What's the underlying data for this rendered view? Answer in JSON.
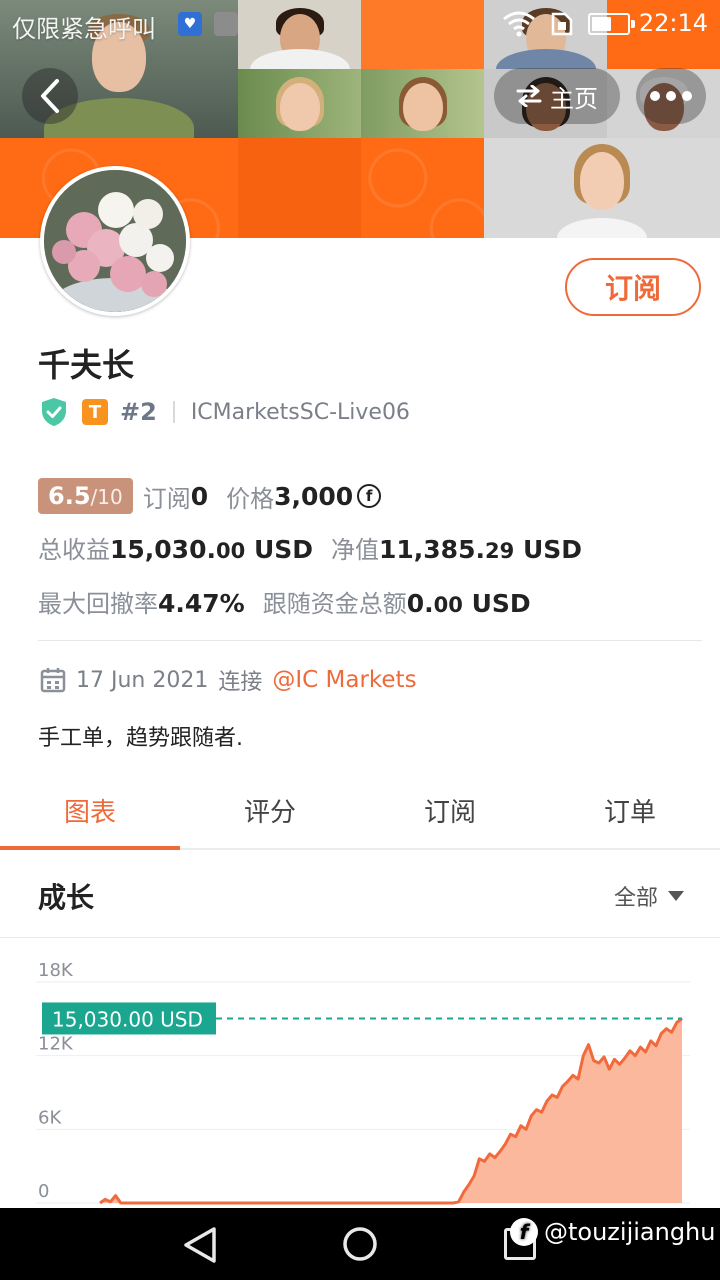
{
  "status_bar": {
    "carrier": "仅限紧急呼叫",
    "time": "22:14",
    "battery_level": 0.55,
    "icons": [
      "health-icon",
      "gallery-icon",
      "wifi-icon",
      "sim-icon",
      "battery-icon"
    ]
  },
  "header": {
    "home_label": "主页"
  },
  "subscribe_label": "订阅",
  "profile": {
    "name": "千夫长",
    "tier": "T",
    "rank": "#2",
    "server": "ICMarketsSC-Live06"
  },
  "stats": {
    "score_value": "6.5",
    "score_max": "/10",
    "subscriptions_label": "订阅",
    "subscriptions_value": "0",
    "price_label": "价格",
    "price_value": "3,000",
    "total_profit_label": "总收益",
    "total_profit_int": "15,030.",
    "total_profit_dec": "00",
    "total_profit_unit": "USD",
    "equity_label": "净值",
    "equity_int": "11,385.",
    "equity_dec": "29",
    "equity_unit": "USD",
    "max_drawdown_label": "最大回撤率",
    "max_drawdown_value": "4.47%",
    "follow_funds_label": "跟随资金总额",
    "follow_funds_int": "0.",
    "follow_funds_dec": "00",
    "follow_funds_unit": "USD"
  },
  "join": {
    "date": "17 Jun 2021",
    "connect_label": "连接",
    "broker": "@IC Markets"
  },
  "bio": "手工单，趋势跟随者.",
  "tabs": [
    {
      "label": "图表",
      "active": true
    },
    {
      "label": "评分",
      "active": false
    },
    {
      "label": "订阅",
      "active": false
    },
    {
      "label": "订单",
      "active": false
    }
  ],
  "growth": {
    "title": "成长",
    "range": "全部"
  },
  "chart_data": {
    "type": "area",
    "y_ticks": [
      "18K",
      "12K",
      "6K",
      "0"
    ],
    "ylim": [
      0,
      18000
    ],
    "current_value_label": "15,030.00 USD",
    "current_value": 15030,
    "colors": {
      "line": "#f26a3c",
      "fill": "#fbb89c",
      "marker": "#1aa68f"
    },
    "values": [
      0,
      300,
      100,
      600,
      0,
      0,
      0,
      0,
      0,
      0,
      0,
      0,
      0,
      0,
      0,
      0,
      0,
      0,
      0,
      0,
      0,
      0,
      0,
      0,
      0,
      0,
      0,
      0,
      0,
      0,
      0,
      0,
      0,
      0,
      0,
      0,
      0,
      0,
      0,
      0,
      0,
      0,
      0,
      0,
      0,
      0,
      0,
      0,
      0,
      0,
      0,
      0,
      0,
      0,
      0,
      0,
      0,
      0,
      0,
      0,
      0,
      0,
      0,
      0,
      0,
      0,
      0,
      0,
      0,
      100,
      900,
      1500,
      2200,
      3600,
      3400,
      4000,
      3700,
      4200,
      4800,
      5600,
      5400,
      6300,
      6000,
      7100,
      7600,
      7400,
      8300,
      8800,
      8600,
      9500,
      9900,
      10400,
      10100,
      12000,
      12900,
      11600,
      11400,
      11900,
      10900,
      11700,
      11300,
      11800,
      12400,
      12000,
      12700,
      12300,
      13200,
      12800,
      13800,
      14200,
      13900,
      14700,
      15030
    ]
  },
  "watermark": "@touzijianghu"
}
